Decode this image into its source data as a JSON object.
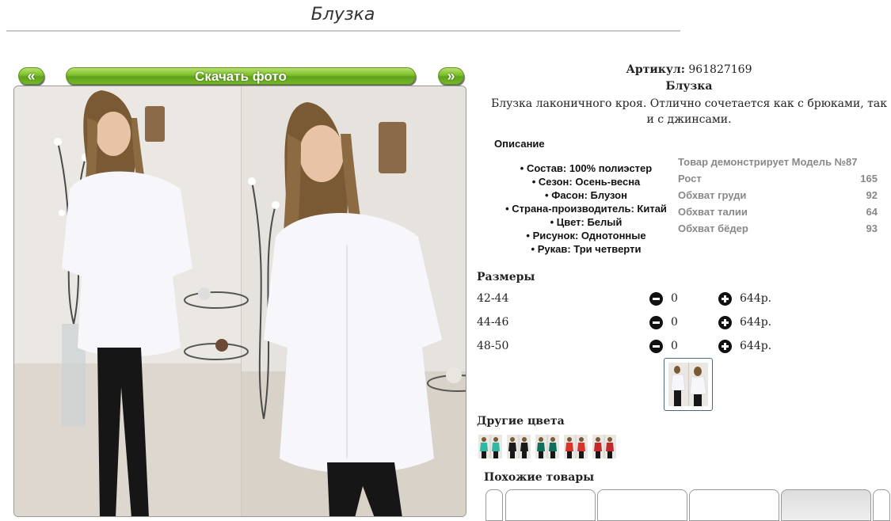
{
  "page": {
    "title": "Блузка"
  },
  "nav": {
    "prev_label": "«",
    "next_label": "»",
    "download_label": "Скачать фото"
  },
  "product": {
    "article_label": "Артикул:",
    "article_value": "961827169",
    "name": "Блузка",
    "description": "Блузка лаконичного кроя. Отлично сочетается как с брюками, так и с джинсами."
  },
  "specs": {
    "heading": "Описание",
    "items": [
      "Состав: 100% полиэстер",
      "Сезон: Осень-весна",
      "Фасон: Блузон",
      "Страна-производитель: Китай",
      "Цвет: Белый",
      "Рисунок: Однотонные",
      "Рукав: Три четверти"
    ]
  },
  "model": {
    "title": "Товар демонстрирует Модель №87",
    "rows": [
      {
        "label": "Рост",
        "value": "165"
      },
      {
        "label": "Обхват груди",
        "value": "92"
      },
      {
        "label": "Обхват талии",
        "value": "64"
      },
      {
        "label": "Обхват бёдер",
        "value": "93"
      }
    ]
  },
  "sizes": {
    "heading": "Размеры",
    "rows": [
      {
        "size": "42-44",
        "qty": "0",
        "price": "644р."
      },
      {
        "size": "44-46",
        "qty": "0",
        "price": "644р."
      },
      {
        "size": "48-50",
        "qty": "0",
        "price": "644р."
      }
    ]
  },
  "other_colors": {
    "heading": "Другие цвета",
    "swatches": [
      "#2fb8a4",
      "#1a1a1a",
      "#0f6e5c",
      "#d9342b",
      "#c52a2a"
    ]
  },
  "similar": {
    "heading": "Похожие товары"
  },
  "colors": {
    "accent_green": "#6db12a",
    "blouse_white": "#f7f7fb",
    "price_text": "#222222"
  },
  "icons": {
    "minus": "minus-circle-icon",
    "plus": "plus-circle-icon"
  }
}
